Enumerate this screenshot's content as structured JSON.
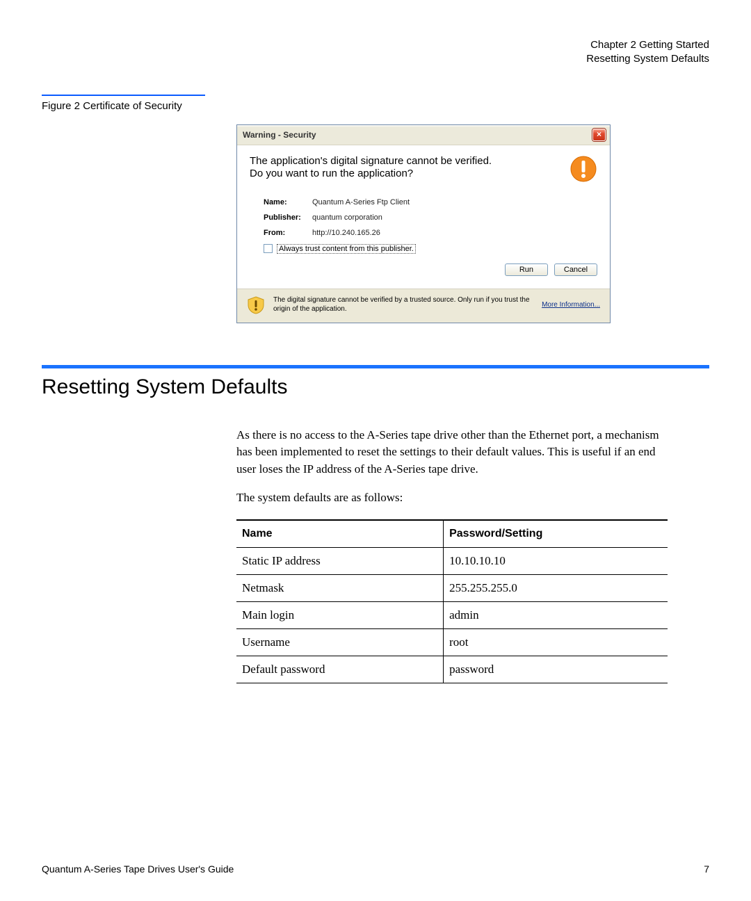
{
  "header": {
    "chapter": "Chapter 2  Getting Started",
    "section": "Resetting System Defaults"
  },
  "figure": {
    "caption": "Figure 2  Certificate of Security"
  },
  "dialog": {
    "title": "Warning - Security",
    "message_line1": "The application's digital signature cannot be verified.",
    "message_line2": "Do you want to run the application?",
    "labels": {
      "name": "Name:",
      "publisher": "Publisher:",
      "from": "From:"
    },
    "values": {
      "name": "Quantum A-Series Ftp Client",
      "publisher": "quantum corporation",
      "from": "http://10.240.165.26"
    },
    "always_trust": "Always trust content from this publisher.",
    "buttons": {
      "run": "Run",
      "cancel": "Cancel"
    },
    "footer_text": "The digital signature cannot be verified by a trusted source.  Only run if you trust the origin of the application.",
    "more_info": "More Information..."
  },
  "section_title": "Resetting System Defaults",
  "body": {
    "p1": "As there is no access to the A-Series tape drive other than the Ethernet port, a mechanism has been implemented to reset the settings to their default values. This is useful if an end user loses the IP address of the A-Series tape drive.",
    "p2": "The system defaults are as follows:"
  },
  "table": {
    "headers": {
      "name": "Name",
      "setting": "Password/Setting"
    },
    "rows": [
      {
        "name": "Static IP address",
        "setting": "10.10.10.10"
      },
      {
        "name": "Netmask",
        "setting": "255.255.255.0"
      },
      {
        "name": "Main login",
        "setting": "admin"
      },
      {
        "name": "Username",
        "setting": "root"
      },
      {
        "name": "Default password",
        "setting": "password"
      }
    ]
  },
  "footer": {
    "left": "Quantum A-Series Tape Drives User's Guide",
    "right": "7"
  }
}
